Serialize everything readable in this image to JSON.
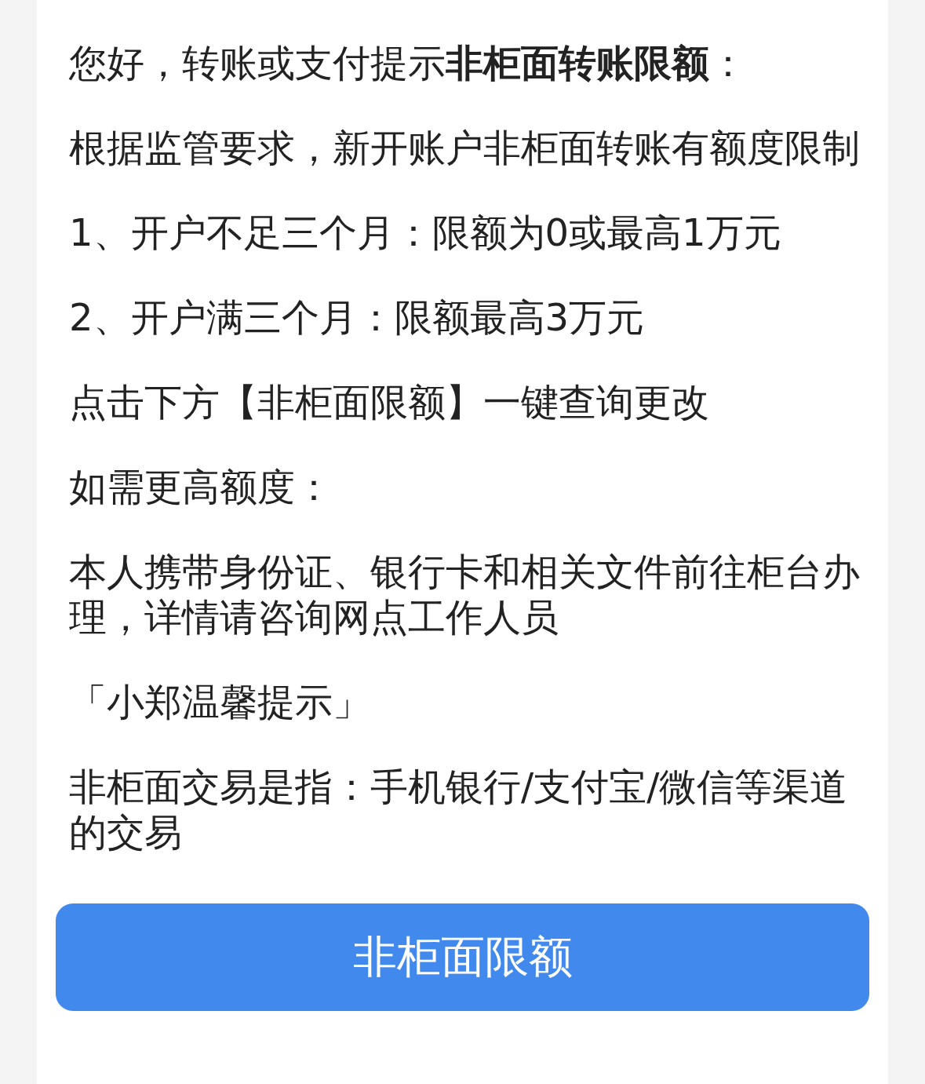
{
  "paragraphs": [
    "您好，转账或支付提示**非柜面转账限额**：",
    "根据监管要求，新开账户非柜面转账有额度限制",
    "1、开户不足三个月：限额为0或最高1万元",
    "2、开户满三个月：限额最高3万元",
    "点击下方【非柜面限额】一键查询更改",
    "如需更高额度：",
    "本人携带身份证、银行卡和相关文件前往柜台办理，详情请咨询网点工作人员",
    "「小郑温馨提示」",
    "非柜面交易是指：手机银行/支付宝/微信等渠道的交易"
  ],
  "button": {
    "label": "非柜面限额"
  }
}
